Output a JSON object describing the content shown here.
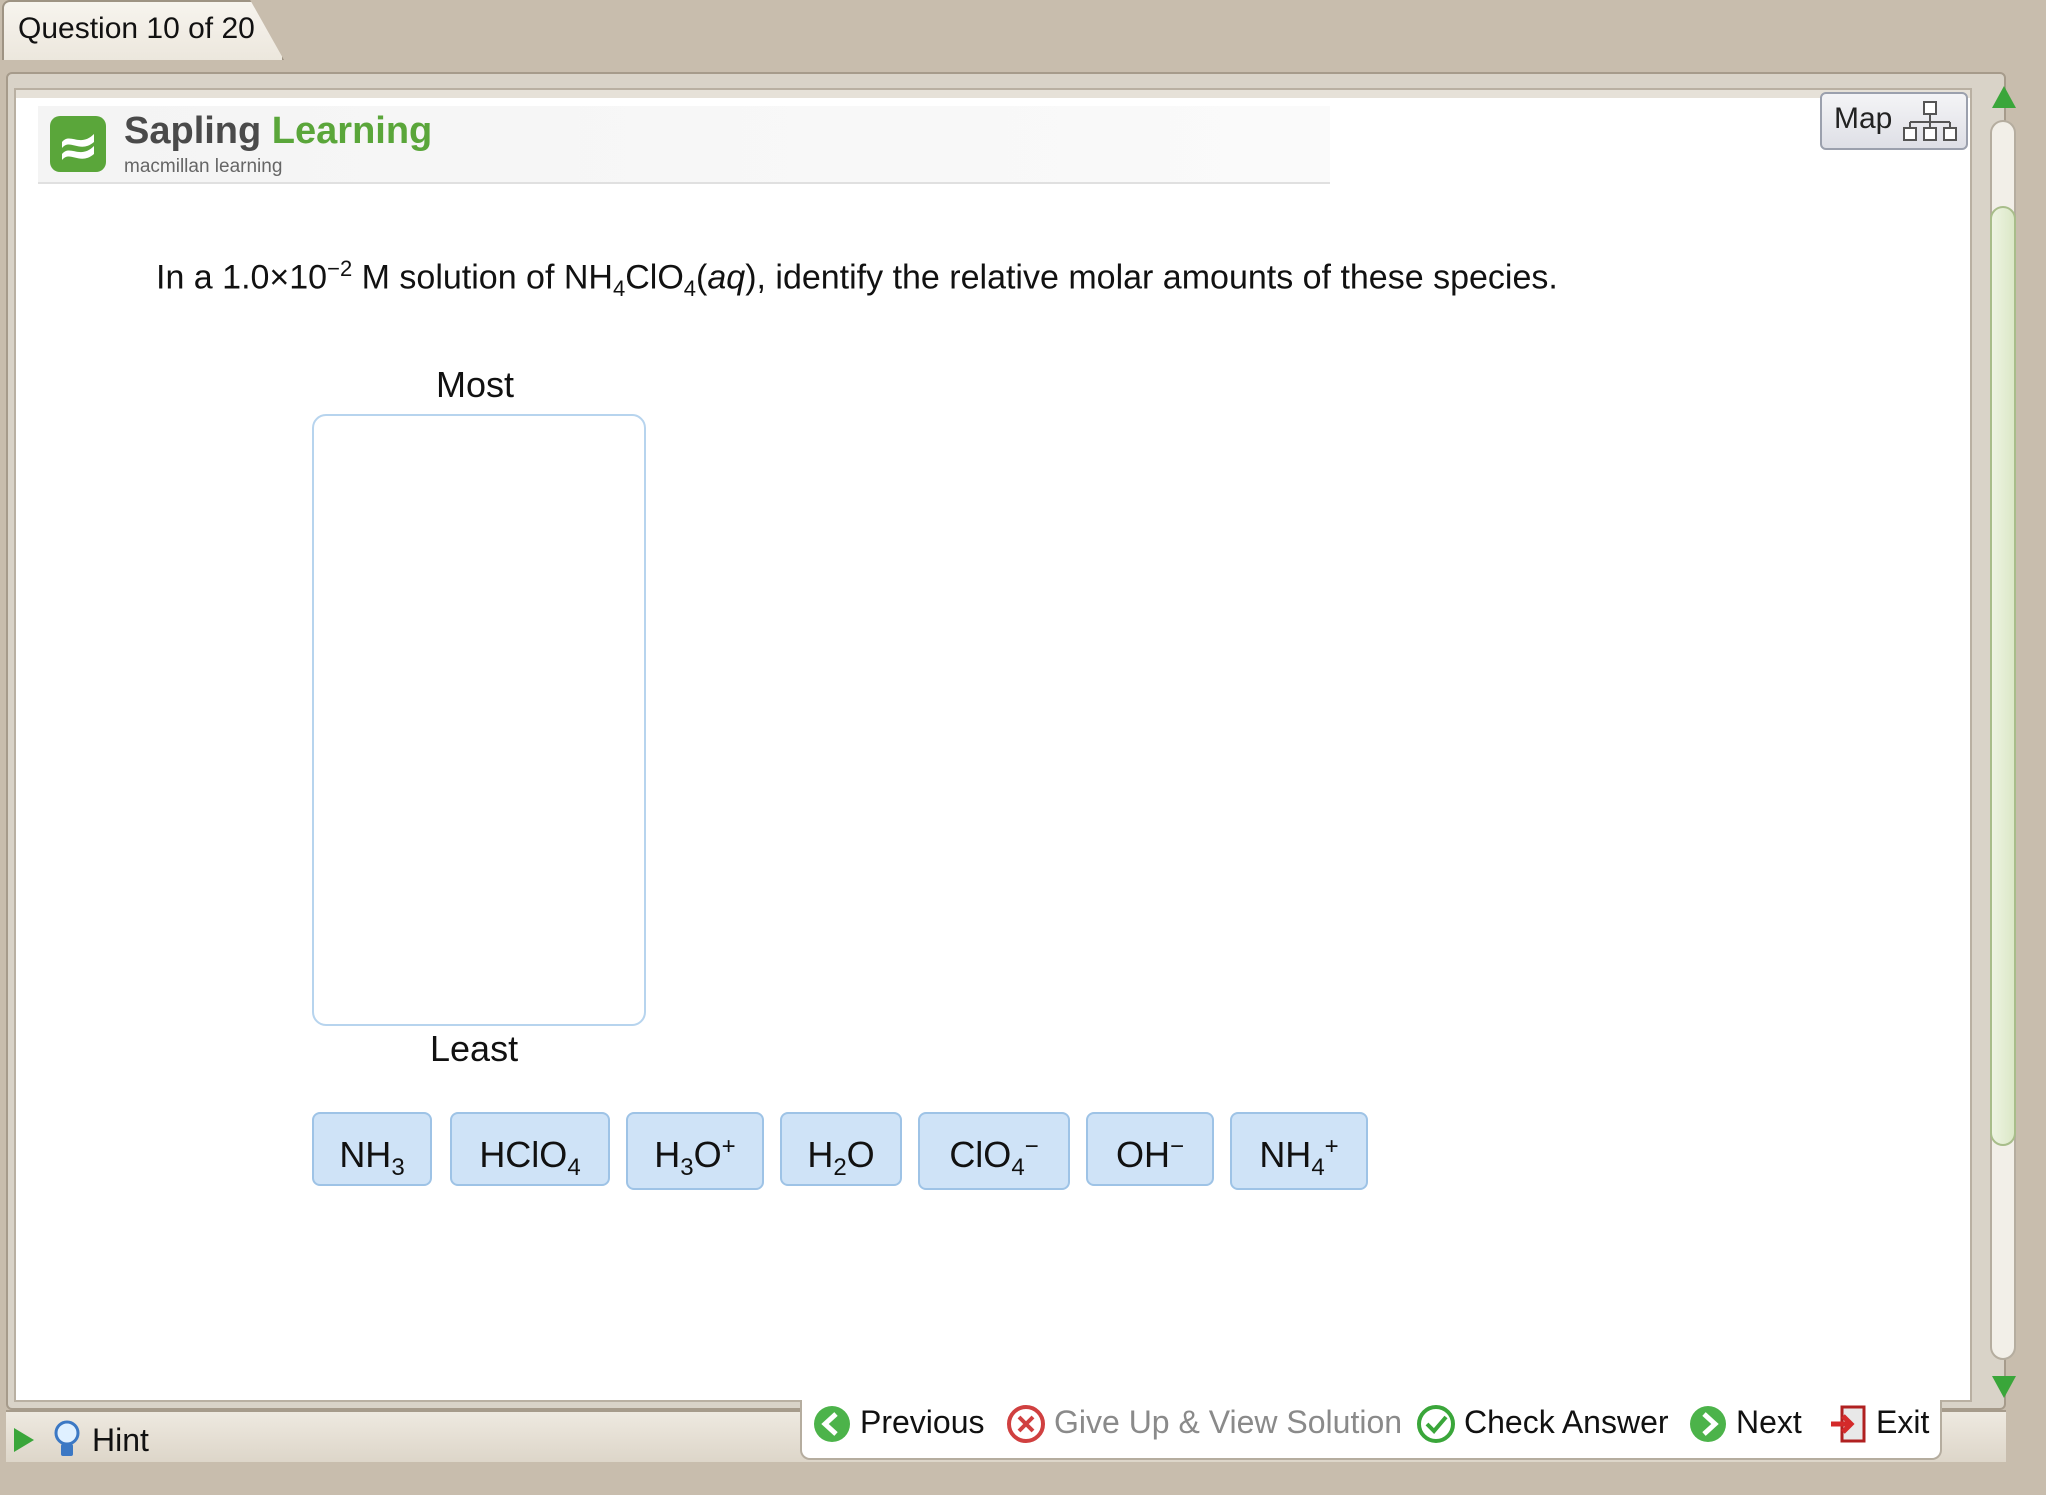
{
  "tab": {
    "label": "Question 10 of 20"
  },
  "logo": {
    "name_a": "Sapling",
    "name_b": "Learning",
    "sub": "macmillan learning"
  },
  "map_button": {
    "label": "Map"
  },
  "question": {
    "p1": "In a 1.0×10",
    "exp": "−2",
    "p2": " M solution of NH",
    "s1": "4",
    "p3": "ClO",
    "s2": "4",
    "p4": "(",
    "aq": "aq",
    "p5": "), identify the relative molar amounts of these species."
  },
  "ranking": {
    "top_label": "Most",
    "bottom_label": "Least"
  },
  "species": [
    {
      "base": "NH",
      "sub": "3",
      "tail": "",
      "sup": ""
    },
    {
      "base": "HClO",
      "sub": "4",
      "tail": "",
      "sup": ""
    },
    {
      "base": "H",
      "sub": "3",
      "tail": "O",
      "sup": "+"
    },
    {
      "base": "H",
      "sub": "2",
      "tail": "O",
      "sup": ""
    },
    {
      "base": "ClO",
      "sub": "4",
      "tail": "",
      "sup": "−"
    },
    {
      "base": "OH",
      "sub": "",
      "tail": "",
      "sup": "−"
    },
    {
      "base": "NH",
      "sub": "4",
      "tail": "",
      "sup": "+"
    }
  ],
  "toolbar": {
    "hint": "Hint",
    "previous": "Previous",
    "give_up": "Give Up & View Solution",
    "check": "Check Answer",
    "next": "Next",
    "exit": "Exit"
  },
  "colors": {
    "accent_green": "#3aa63a",
    "tile_blue": "#cfe3f7",
    "exit_red": "#d42a2a"
  }
}
